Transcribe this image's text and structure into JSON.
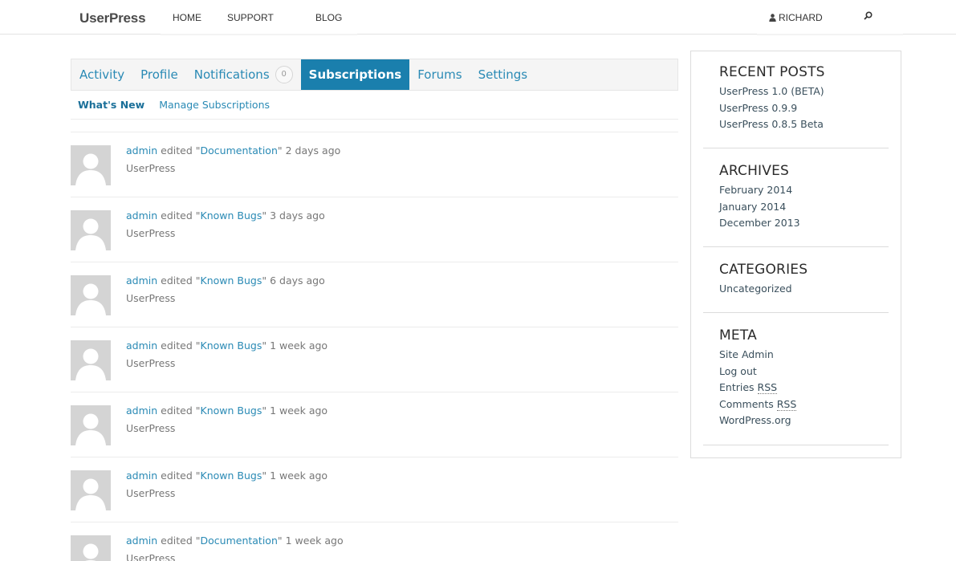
{
  "topnav": {
    "logo": "UserPress",
    "links": [
      "HOME",
      "SUPPORT",
      "BLOG"
    ],
    "user": "RICHARD",
    "user_icon": "person-icon",
    "search_icon": "search-icon"
  },
  "tabs": {
    "items": [
      "Activity",
      "Profile",
      "Notifications",
      "Subscriptions",
      "Forums",
      "Settings"
    ],
    "notifications_count": "0",
    "active": "Subscriptions"
  },
  "subtabs": {
    "items": [
      "What's New",
      "Manage Subscriptions"
    ],
    "active": "What's New"
  },
  "activity": [
    {
      "user": "admin",
      "action": "edited",
      "quote_open": "\"",
      "page": "Documentation",
      "quote_close": "\"",
      "time": "2 days ago",
      "site": "UserPress"
    },
    {
      "user": "admin",
      "action": "edited",
      "quote_open": "\"",
      "page": "Known Bugs",
      "quote_close": "\"",
      "time": "3 days ago",
      "site": "UserPress"
    },
    {
      "user": "admin",
      "action": "edited",
      "quote_open": "\"",
      "page": "Known Bugs",
      "quote_close": "\"",
      "time": "6 days ago",
      "site": "UserPress"
    },
    {
      "user": "admin",
      "action": "edited",
      "quote_open": "\"",
      "page": "Known Bugs",
      "quote_close": "\"",
      "time": "1 week ago",
      "site": "UserPress"
    },
    {
      "user": "admin",
      "action": "edited",
      "quote_open": "\"",
      "page": "Known Bugs",
      "quote_close": "\"",
      "time": "1 week ago",
      "site": "UserPress"
    },
    {
      "user": "admin",
      "action": "edited",
      "quote_open": "\"",
      "page": "Known Bugs",
      "quote_close": "\"",
      "time": "1 week ago",
      "site": "UserPress"
    },
    {
      "user": "admin",
      "action": "edited",
      "quote_open": "\"",
      "page": "Documentation",
      "quote_close": "\"",
      "time": "1 week ago",
      "site": "UserPress"
    }
  ],
  "sidebar": {
    "recent_posts": {
      "title": "RECENT POSTS",
      "items": [
        "UserPress 1.0 (BETA)",
        "UserPress 0.9.9",
        "UserPress 0.8.5 Beta"
      ]
    },
    "archives": {
      "title": "ARCHIVES",
      "items": [
        "February 2014",
        "January 2014",
        "December 2013"
      ]
    },
    "categories": {
      "title": "CATEGORIES",
      "items": [
        "Uncategorized"
      ]
    },
    "meta": {
      "title": "META",
      "site_admin": "Site Admin",
      "log_out": "Log out",
      "entries": "Entries",
      "comments": "Comments",
      "rss": "RSS",
      "wordpress": "WordPress.org"
    }
  },
  "colors": {
    "accent": "#1a7fad",
    "link": "#2a8ab5"
  }
}
